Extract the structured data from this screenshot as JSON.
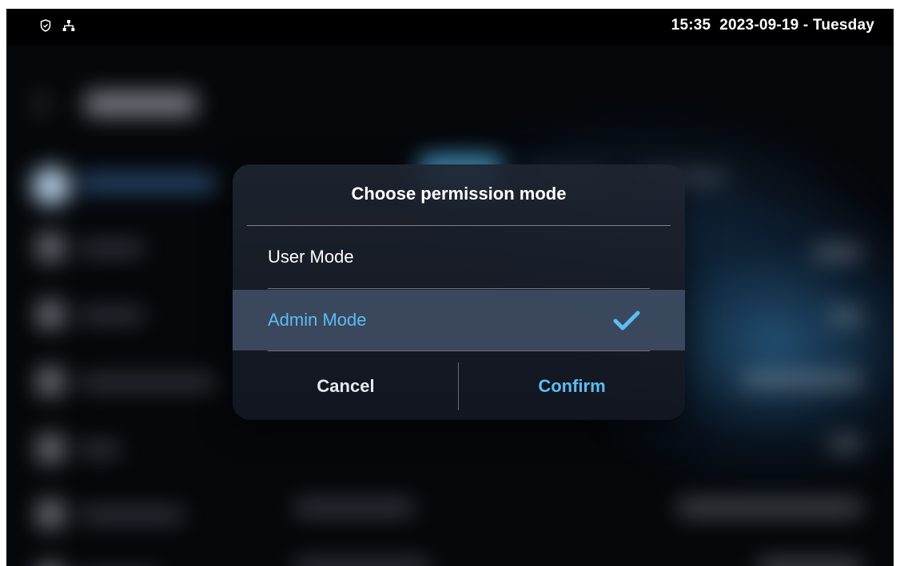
{
  "status_bar": {
    "icons": [
      "shield-icon",
      "network-icon"
    ],
    "time": "15:35",
    "date": "2023-09-19 - Tuesday"
  },
  "dialog": {
    "title": "Choose permission mode",
    "options": [
      {
        "label": "User Mode",
        "selected": false
      },
      {
        "label": "Admin Mode",
        "selected": true
      }
    ],
    "cancel_label": "Cancel",
    "confirm_label": "Confirm"
  },
  "colors": {
    "accent": "#5bbdf2",
    "selected_row": "#4a5a72",
    "dialog_bg": "#1e2430",
    "status_bar_bg": "#000000"
  }
}
